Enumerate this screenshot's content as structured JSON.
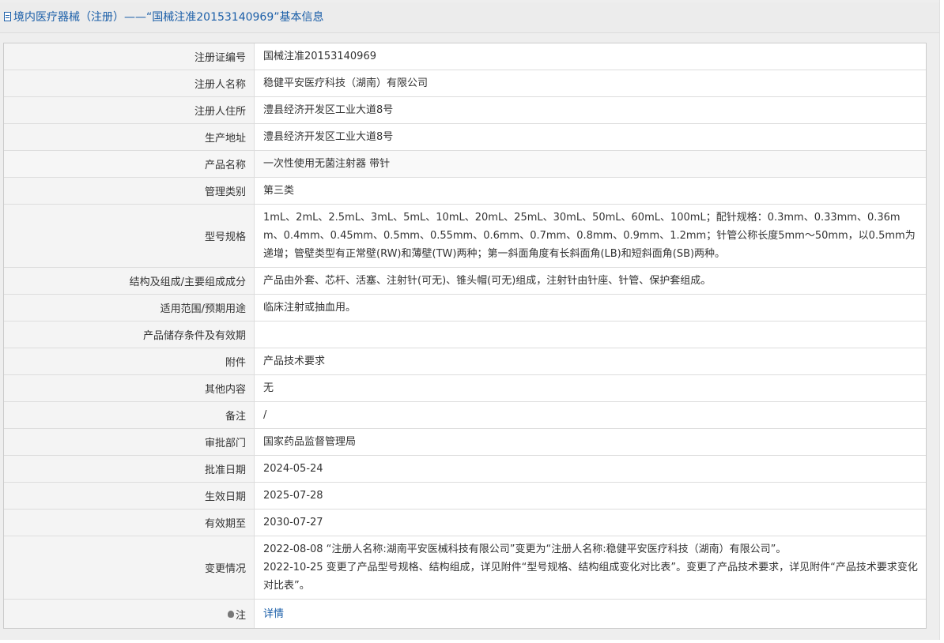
{
  "page": {
    "title": "境内医疗器械（注册）——“国械注准20153140969”基本信息"
  },
  "fields": [
    {
      "label": "注册证编号",
      "value": "国械注准20153140969"
    },
    {
      "label": "注册人名称",
      "value": "稳健平安医疗科技（湖南）有限公司"
    },
    {
      "label": "注册人住所",
      "value": "澧县经济开发区工业大道8号"
    },
    {
      "label": "生产地址",
      "value": "澧县经济开发区工业大道8号"
    },
    {
      "label": "产品名称",
      "value": "一次性使用无菌注射器 带针"
    },
    {
      "label": "管理类别",
      "value": "第三类"
    },
    {
      "label": "型号规格",
      "value": "1mL、2mL、2.5mL、3mL、5mL、10mL、20mL、25mL、30mL、50mL、60mL、100mL；配针规格：0.3mm、0.33mm、0.36mm、0.4mm、0.45mm、0.5mm、0.55mm、0.6mm、0.7mm、0.8mm、0.9mm、1.2mm；针管公称长度5mm～50mm，以0.5mm为递增；管壁类型有正常壁(RW)和薄壁(TW)两种；第一斜面角度有长斜面角(LB)和短斜面角(SB)两种。"
    },
    {
      "label": "结构及组成/主要组成成分",
      "value": "产品由外套、芯杆、活塞、注射针(可无)、锥头帽(可无)组成，注射针由针座、针管、保护套组成。"
    },
    {
      "label": "适用范围/预期用途",
      "value": "临床注射或抽血用。"
    },
    {
      "label": "产品储存条件及有效期",
      "value": ""
    },
    {
      "label": "附件",
      "value": "产品技术要求"
    },
    {
      "label": "其他内容",
      "value": "无"
    },
    {
      "label": "备注",
      "value": "/"
    },
    {
      "label": "审批部门",
      "value": "国家药品监督管理局"
    },
    {
      "label": "批准日期",
      "value": "2024-05-24"
    },
    {
      "label": "生效日期",
      "value": "2025-07-28"
    },
    {
      "label": "有效期至",
      "value": "2030-07-27"
    }
  ],
  "changes": {
    "label": "变更情况",
    "entries": [
      "2022-08-08 “注册人名称:湖南平安医械科技有限公司”变更为“注册人名称:稳健平安医疗科技（湖南）有限公司”。",
      "2022-10-25 变更了产品型号规格、结构组成，详见附件“型号规格、结构组成变化对比表”。变更了产品技术要求，详见附件“产品技术要求变化对比表”。"
    ]
  },
  "note": {
    "icon": "lightbulb-icon",
    "label": "注",
    "link_text": "详情"
  },
  "colors": {
    "title": "#1a5ea8",
    "link": "#1a5ea8",
    "label_bg": "#f4f4f4",
    "border": "#dddddd"
  }
}
